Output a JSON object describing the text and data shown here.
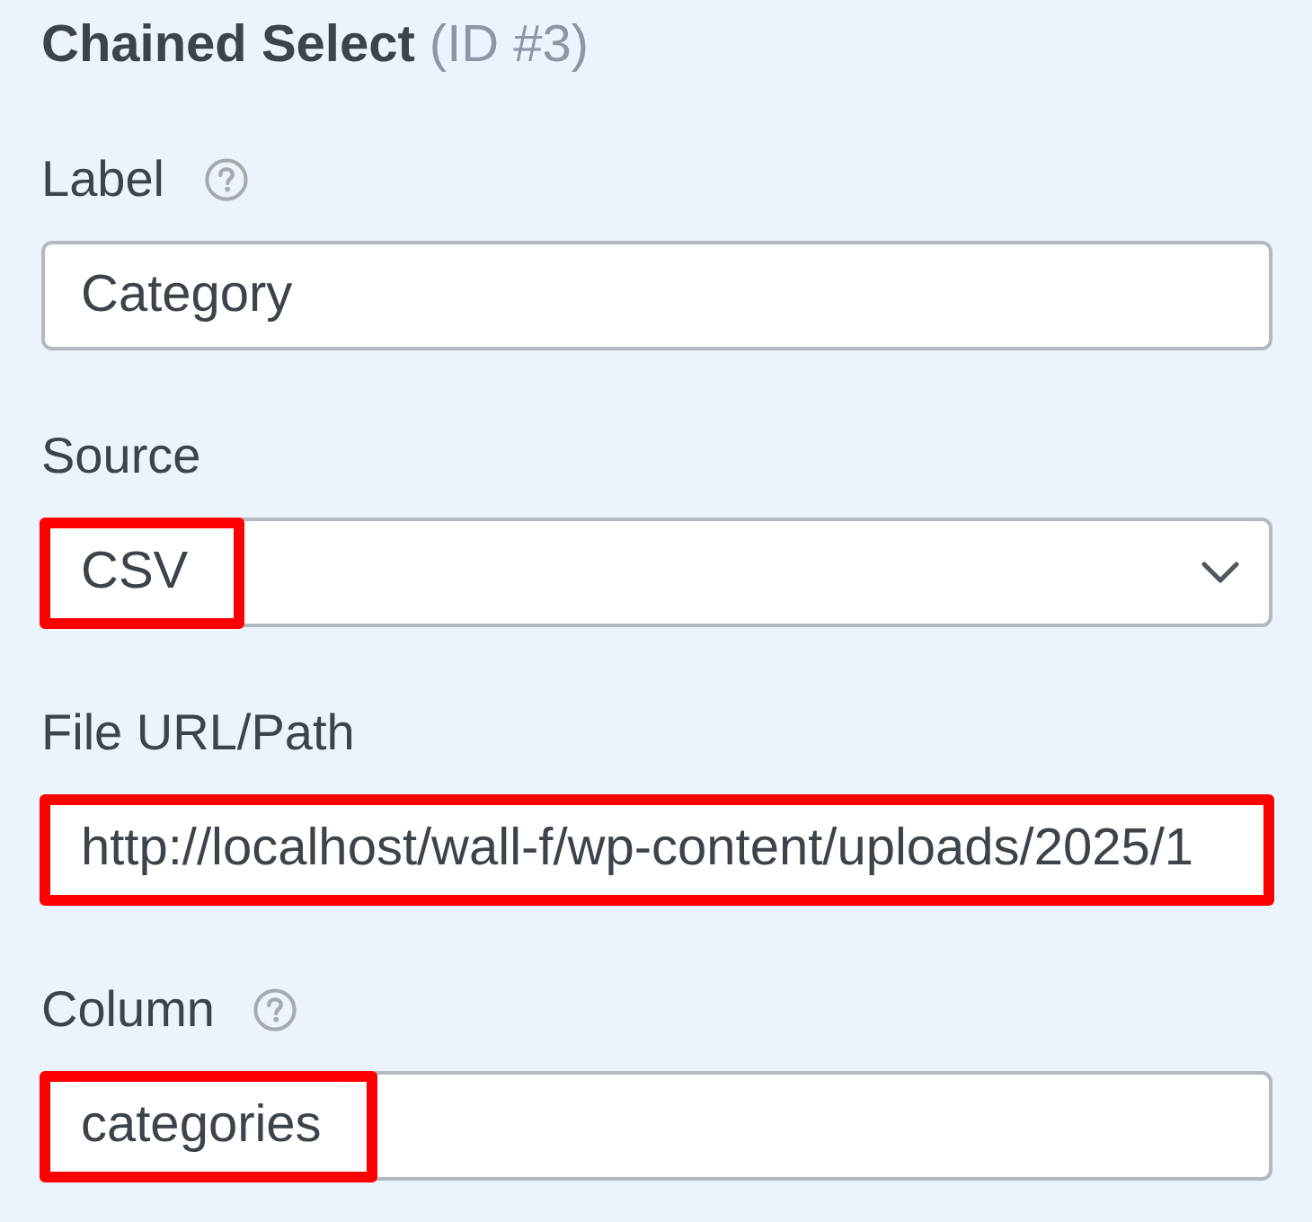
{
  "panel": {
    "title": "Chained Select",
    "id_label": "(ID #3)"
  },
  "fields": [
    {
      "kind": "text",
      "label": "Label",
      "help": true,
      "value": "Category",
      "value_highlighted": false,
      "field_highlighted": false
    },
    {
      "kind": "select",
      "label": "Source",
      "help": false,
      "value": "CSV",
      "value_highlighted": true,
      "field_highlighted": false
    },
    {
      "kind": "text",
      "label": "File URL/Path",
      "help": false,
      "value": "http://localhost/wall-f/wp-content/uploads/2025/1",
      "value_highlighted": false,
      "field_highlighted": true
    },
    {
      "kind": "text",
      "label": "Column",
      "help": true,
      "value": "categories",
      "value_highlighted": true,
      "field_highlighted": false
    }
  ]
}
